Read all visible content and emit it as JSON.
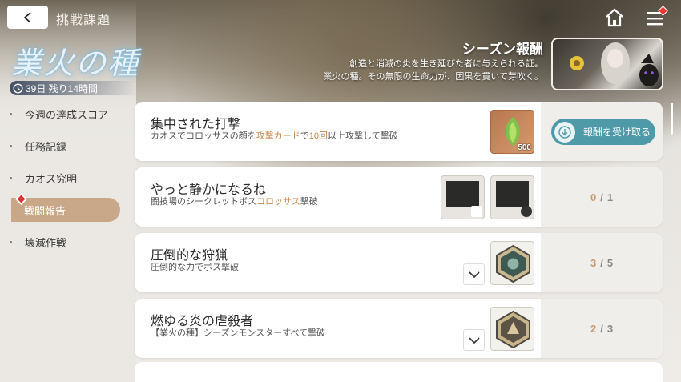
{
  "header": {
    "title": "挑戦課題"
  },
  "event": {
    "logo_text": "業火の種",
    "timer": "39日 残り14時間"
  },
  "season": {
    "title": "シーズン報酬",
    "desc_line1": "創造と消滅の炎を生き延びた者に与えられる証。",
    "desc_line2": "業火の種。その無限の生命力が、因果を貫いて芽吹く。"
  },
  "sidebar": {
    "items": [
      {
        "label": "今週の達成スコア"
      },
      {
        "label": "任務記録"
      },
      {
        "label": "カオス究明"
      },
      {
        "label": "戦闘報告"
      },
      {
        "label": "壊滅作戦"
      }
    ]
  },
  "missions": [
    {
      "title": "集中された打撃",
      "desc_parts": [
        "カオスでコロッサスの顔を",
        "攻撃カード",
        "で",
        "10回",
        "以上攻撃して撃破"
      ],
      "reward_qty": "500",
      "claim_label": "報酬を受け取る"
    },
    {
      "title": "やっと静かになるね",
      "desc_parts": [
        "闘技場のシークレットボス",
        "コロッサス",
        "撃破"
      ],
      "progress_current": "0",
      "progress_sep": "/",
      "progress_total": "1"
    },
    {
      "title": "圧倒的な狩猟",
      "desc": "圧倒的な力でボス撃破",
      "progress_current": "3",
      "progress_sep": "/",
      "progress_total": "5"
    },
    {
      "title": "燃ゆる炎の虐殺者",
      "desc": "【業火の種】シーズンモンスターすべて撃破",
      "progress_current": "2",
      "progress_sep": "/",
      "progress_total": "3"
    }
  ],
  "colors": {
    "accent": "#c9a88a",
    "highlight": "#c9874a",
    "claim": "#4e9aa8"
  }
}
